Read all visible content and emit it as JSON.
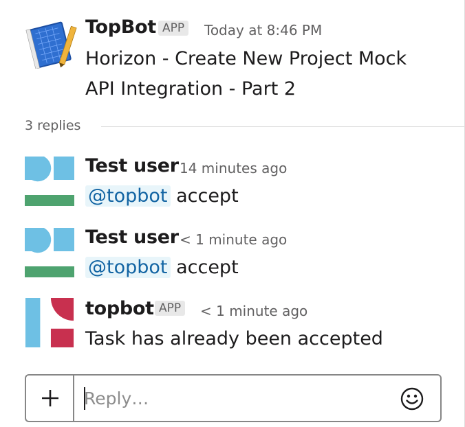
{
  "parent": {
    "author": "TopBot",
    "badge": "APP",
    "time": "Today at 8:46 PM",
    "lines": [
      "Horizon - Create New Project Mock",
      "API Integration - Part 2"
    ],
    "avatar_icon": "blueprint-book-icon"
  },
  "thread": {
    "replies_label": "3 replies"
  },
  "replies": [
    {
      "author": "Test user",
      "time": "14 minutes ago",
      "mention": "@topbot",
      "text": " accept",
      "avatar_icon": "user-avatar-icon"
    },
    {
      "author": "Test user",
      "time": "< 1 minute ago",
      "mention": "@topbot",
      "text": " accept",
      "avatar_icon": "user-avatar-icon"
    },
    {
      "author": "topbot",
      "badge": "APP",
      "time": "< 1 minute ago",
      "text": "Task has already been accepted",
      "avatar_icon": "bot-avatar-icon"
    }
  ],
  "composer": {
    "placeholder": "Reply…",
    "value": "",
    "add_icon": "plus-icon",
    "emoji_icon": "smiley-icon"
  },
  "colors": {
    "mention_bg": "#e8f5fa",
    "mention_text": "#1264a3",
    "user_avatar_blue": "#6ec0e4",
    "user_avatar_green": "#4ea36f",
    "bot_avatar_red": "#c8304f",
    "bot_avatar_blue": "#6ec0e4",
    "badge_bg": "#e8e8e8"
  }
}
